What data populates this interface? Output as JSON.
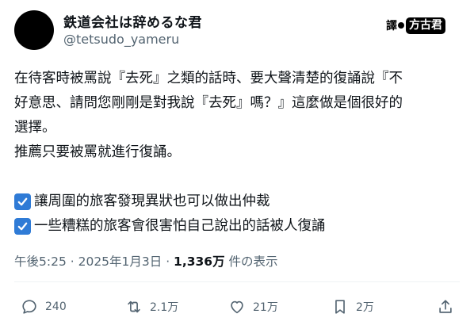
{
  "author": {
    "display_name": "鉄道会社は辞めるな君",
    "handle": "@tetsudo_yameru"
  },
  "translation_badge": {
    "left": "譯",
    "right": "方古君"
  },
  "post": {
    "lines": [
      "在待客時被罵說『去死』之類的話時、要大聲清楚的復誦說『不",
      "好意思、請問您剛剛是對我說『去死』嗎？』這麼做是個很好的",
      "選擇。",
      "推薦只要被罵就進行復誦。"
    ],
    "checklist": [
      "讓周圍的旅客發現異狀也可以做出仲裁",
      "一些糟糕的旅客會很害怕自己說出的話被人復誦"
    ]
  },
  "meta": {
    "time": "午後5:25",
    "separator": " · ",
    "date": "2025年1月3日",
    "views_count": "1,336万",
    "views_label": " 件の表示"
  },
  "actions": {
    "replies": "240",
    "reposts": "2.1万",
    "likes": "21万",
    "bookmarks": "2万"
  },
  "colors": {
    "text": "#0f1419",
    "muted": "#536471",
    "checkbox": "#2f7bd6"
  },
  "icons": [
    "reply-icon",
    "repost-icon",
    "like-icon",
    "bookmark-icon",
    "share-icon",
    "check-icon"
  ]
}
